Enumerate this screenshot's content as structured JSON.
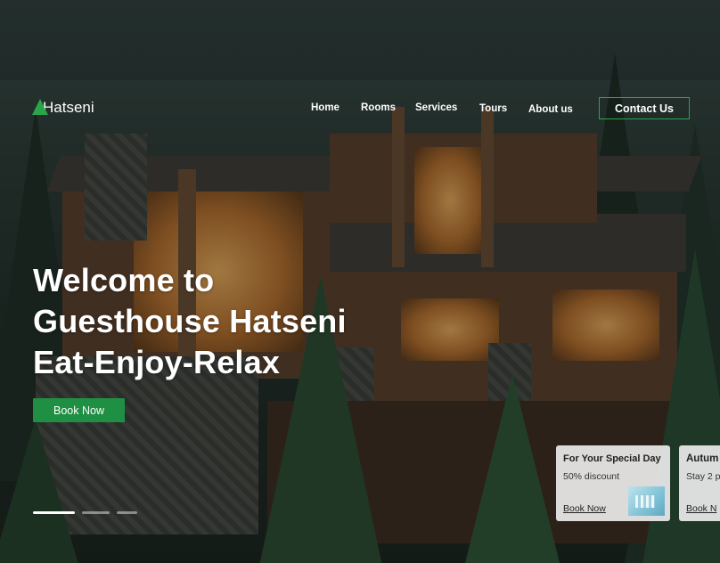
{
  "brand": {
    "name": "Hatseni",
    "logo_icon": "green-triangle-icon",
    "accent": "#2aa64a"
  },
  "nav": {
    "items": [
      {
        "label": "Home"
      },
      {
        "label": "Rooms"
      },
      {
        "label": "Services"
      },
      {
        "label": "Tours"
      },
      {
        "label": "About us"
      }
    ],
    "contact_label": "Contact Us"
  },
  "hero": {
    "line1": "Welcome to",
    "line2": "Guesthouse Hatseni",
    "line3": "Eat-Enjoy-Relax",
    "cta_label": "Book Now",
    "cta_color": "#1f8f43"
  },
  "slider": {
    "count": 3,
    "active_index": 0
  },
  "cards": [
    {
      "title": "For Your Special Day",
      "subtitle": "50% discount",
      "link": "Book Now"
    },
    {
      "title": "Autum",
      "subtitle": "Stay 2 p",
      "link": "Book N"
    }
  ]
}
